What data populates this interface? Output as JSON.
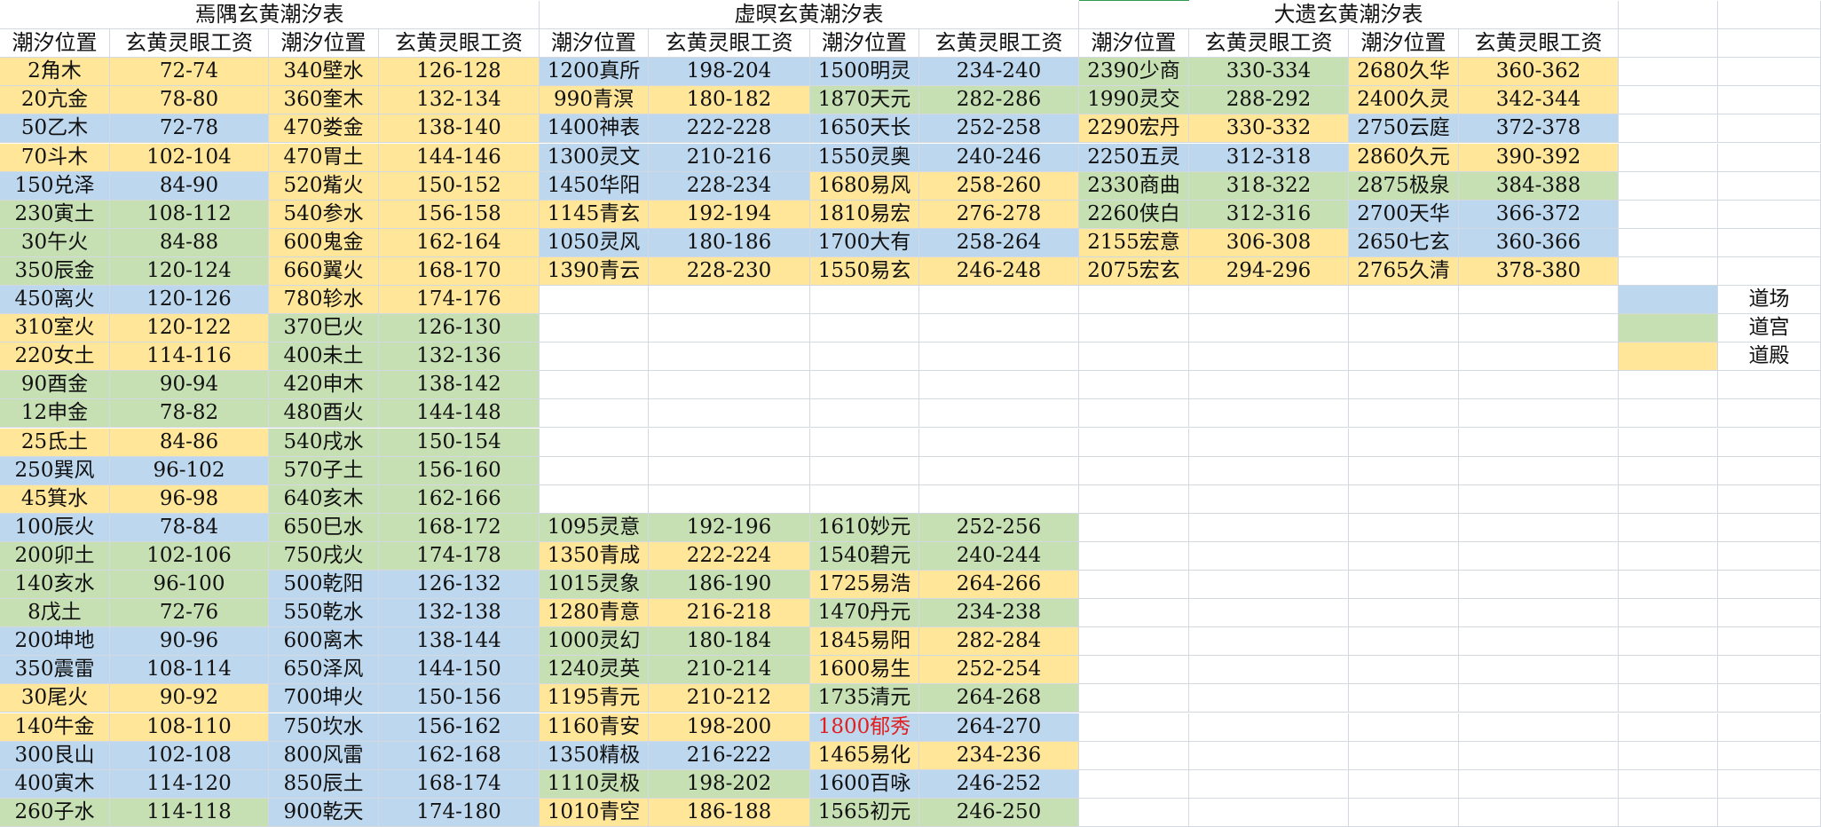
{
  "colors": {
    "blue": "#bdd7ee",
    "green": "#c6e0b4",
    "yellow": "#ffe699",
    "red_text": "#e02020"
  },
  "headers": [
    "潮汐位置",
    "玄黄灵眼工资",
    "潮汐位置",
    "玄黄灵眼工资",
    "潮汐位置",
    "玄黄灵眼工资",
    "潮汐位置",
    "玄黄灵眼工资",
    "潮汐位置",
    "玄黄灵眼工资",
    "潮汐位置",
    "玄黄灵眼工资"
  ],
  "tables": [
    {
      "title": "焉隅玄黄潮汐表"
    },
    {
      "title": "虚暝玄黄潮汐表"
    },
    {
      "title": "大遗玄黄潮汐表"
    }
  ],
  "legend": [
    {
      "label": "道场",
      "color": "blue"
    },
    {
      "label": "道宫",
      "color": "green"
    },
    {
      "label": "道殿",
      "color": "yellow"
    }
  ],
  "rows": [
    [
      [
        "2角木",
        "72-74",
        "yellow"
      ],
      [
        "340壁水",
        "126-128",
        "yellow"
      ],
      [
        "1200真所",
        "198-204",
        "blue"
      ],
      [
        "1500明灵",
        "234-240",
        "blue"
      ],
      [
        "2390少商",
        "330-334",
        "green"
      ],
      [
        "2680久华",
        "360-362",
        "yellow"
      ]
    ],
    [
      [
        "20亢金",
        "78-80",
        "yellow"
      ],
      [
        "360奎木",
        "132-134",
        "yellow"
      ],
      [
        "990青溟",
        "180-182",
        "yellow"
      ],
      [
        "1870天元",
        "282-286",
        "green"
      ],
      [
        "1990灵交",
        "288-292",
        "green"
      ],
      [
        "2400久灵",
        "342-344",
        "yellow"
      ]
    ],
    [
      [
        "50乙木",
        "72-78",
        "blue"
      ],
      [
        "470娄金",
        "138-140",
        "yellow"
      ],
      [
        "1400神表",
        "222-228",
        "blue"
      ],
      [
        "1650天长",
        "252-258",
        "blue"
      ],
      [
        "2290宏丹",
        "330-332",
        "yellow"
      ],
      [
        "2750云庭",
        "372-378",
        "blue"
      ]
    ],
    [
      [
        "70斗木",
        "102-104",
        "yellow"
      ],
      [
        "470胃土",
        "144-146",
        "yellow"
      ],
      [
        "1300灵文",
        "210-216",
        "blue"
      ],
      [
        "1550灵奥",
        "240-246",
        "blue"
      ],
      [
        "2250五灵",
        "312-318",
        "blue"
      ],
      [
        "2860久元",
        "390-392",
        "yellow"
      ]
    ],
    [
      [
        "150兑泽",
        "84-90",
        "blue"
      ],
      [
        "520觜火",
        "150-152",
        "yellow"
      ],
      [
        "1450华阳",
        "228-234",
        "blue"
      ],
      [
        "1680易风",
        "258-260",
        "yellow"
      ],
      [
        "2330商曲",
        "318-322",
        "green"
      ],
      [
        "2875极泉",
        "384-388",
        "green"
      ]
    ],
    [
      [
        "230寅土",
        "108-112",
        "green"
      ],
      [
        "540参水",
        "156-158",
        "yellow"
      ],
      [
        "1145青玄",
        "192-194",
        "yellow"
      ],
      [
        "1810易宏",
        "276-278",
        "yellow"
      ],
      [
        "2260侠白",
        "312-316",
        "green"
      ],
      [
        "2700天华",
        "366-372",
        "blue"
      ]
    ],
    [
      [
        "30午火",
        "84-88",
        "green"
      ],
      [
        "600鬼金",
        "162-164",
        "yellow"
      ],
      [
        "1050灵风",
        "180-186",
        "blue"
      ],
      [
        "1700大有",
        "258-264",
        "blue"
      ],
      [
        "2155宏意",
        "306-308",
        "yellow"
      ],
      [
        "2650七玄",
        "360-366",
        "blue"
      ]
    ],
    [
      [
        "350辰金",
        "120-124",
        "green"
      ],
      [
        "660翼火",
        "168-170",
        "yellow"
      ],
      [
        "1390青云",
        "228-230",
        "yellow"
      ],
      [
        "1550易玄",
        "246-248",
        "yellow"
      ],
      [
        "2075宏玄",
        "294-296",
        "yellow"
      ],
      [
        "2765久清",
        "378-380",
        "yellow"
      ]
    ],
    [
      [
        "450离火",
        "120-126",
        "blue"
      ],
      [
        "780轸水",
        "174-176",
        "yellow"
      ],
      null,
      null,
      null,
      null
    ],
    [
      [
        "310室火",
        "120-122",
        "yellow"
      ],
      [
        "370巳火",
        "126-130",
        "green"
      ],
      null,
      null,
      null,
      null
    ],
    [
      [
        "220女土",
        "114-116",
        "yellow"
      ],
      [
        "400未土",
        "132-136",
        "green"
      ],
      null,
      null,
      null,
      null
    ],
    [
      [
        "90酉金",
        "90-94",
        "green"
      ],
      [
        "420申木",
        "138-142",
        "green"
      ],
      null,
      null,
      null,
      null
    ],
    [
      [
        "12申金",
        "78-82",
        "green"
      ],
      [
        "480酉火",
        "144-148",
        "green"
      ],
      null,
      null,
      null,
      null
    ],
    [
      [
        "25氐土",
        "84-86",
        "yellow"
      ],
      [
        "540戌水",
        "150-154",
        "green"
      ],
      null,
      null,
      null,
      null
    ],
    [
      [
        "250巽风",
        "96-102",
        "blue"
      ],
      [
        "570子土",
        "156-160",
        "green"
      ],
      null,
      null,
      null,
      null
    ],
    [
      [
        "45箕水",
        "96-98",
        "yellow"
      ],
      [
        "640亥木",
        "162-166",
        "green"
      ],
      null,
      null,
      null,
      null
    ],
    [
      [
        "100辰火",
        "78-84",
        "blue"
      ],
      [
        "650巳水",
        "168-172",
        "green"
      ],
      [
        "1095灵意",
        "192-196",
        "green"
      ],
      [
        "1610妙元",
        "252-256",
        "green"
      ],
      null,
      null
    ],
    [
      [
        "200卯土",
        "102-106",
        "green"
      ],
      [
        "750戌火",
        "174-178",
        "green"
      ],
      [
        "1350青成",
        "222-224",
        "yellow"
      ],
      [
        "1540碧元",
        "240-244",
        "green"
      ],
      null,
      null
    ],
    [
      [
        "140亥水",
        "96-100",
        "green"
      ],
      [
        "500乾阳",
        "126-132",
        "blue"
      ],
      [
        "1015灵象",
        "186-190",
        "green"
      ],
      [
        "1725易浩",
        "264-266",
        "yellow"
      ],
      null,
      null
    ],
    [
      [
        "8戊土",
        "72-76",
        "green"
      ],
      [
        "550乾水",
        "132-138",
        "blue"
      ],
      [
        "1280青意",
        "216-218",
        "yellow"
      ],
      [
        "1470丹元",
        "234-238",
        "green"
      ],
      null,
      null
    ],
    [
      [
        "200坤地",
        "90-96",
        "blue"
      ],
      [
        "600离木",
        "138-144",
        "blue"
      ],
      [
        "1000灵幻",
        "180-184",
        "green"
      ],
      [
        "1845易阳",
        "282-284",
        "yellow"
      ],
      null,
      null
    ],
    [
      [
        "350震雷",
        "108-114",
        "blue"
      ],
      [
        "650泽风",
        "144-150",
        "blue"
      ],
      [
        "1240灵英",
        "210-214",
        "green"
      ],
      [
        "1600易生",
        "252-254",
        "yellow"
      ],
      null,
      null
    ],
    [
      [
        "30尾火",
        "90-92",
        "yellow"
      ],
      [
        "700坤火",
        "150-156",
        "blue"
      ],
      [
        "1195青元",
        "210-212",
        "yellow"
      ],
      [
        "1735清元",
        "264-268",
        "green"
      ],
      null,
      null
    ],
    [
      [
        "140牛金",
        "108-110",
        "yellow"
      ],
      [
        "750坎水",
        "156-162",
        "blue"
      ],
      [
        "1160青安",
        "198-200",
        "yellow"
      ],
      [
        "1800郁秀",
        "264-270",
        "blue",
        "red"
      ],
      null,
      null
    ],
    [
      [
        "300艮山",
        "102-108",
        "blue"
      ],
      [
        "800风雷",
        "162-168",
        "blue"
      ],
      [
        "1350精极",
        "216-222",
        "blue"
      ],
      [
        "1465易化",
        "234-236",
        "yellow"
      ],
      null,
      null
    ],
    [
      [
        "400寅木",
        "114-120",
        "blue"
      ],
      [
        "850辰土",
        "168-174",
        "blue"
      ],
      [
        "1110灵极",
        "198-202",
        "green"
      ],
      [
        "1600百咏",
        "246-252",
        "blue"
      ],
      null,
      null
    ],
    [
      [
        "260子水",
        "114-118",
        "green"
      ],
      [
        "900乾天",
        "174-180",
        "blue"
      ],
      [
        "1010青空",
        "186-188",
        "yellow"
      ],
      [
        "1565初元",
        "246-250",
        "green"
      ],
      null,
      null
    ]
  ]
}
